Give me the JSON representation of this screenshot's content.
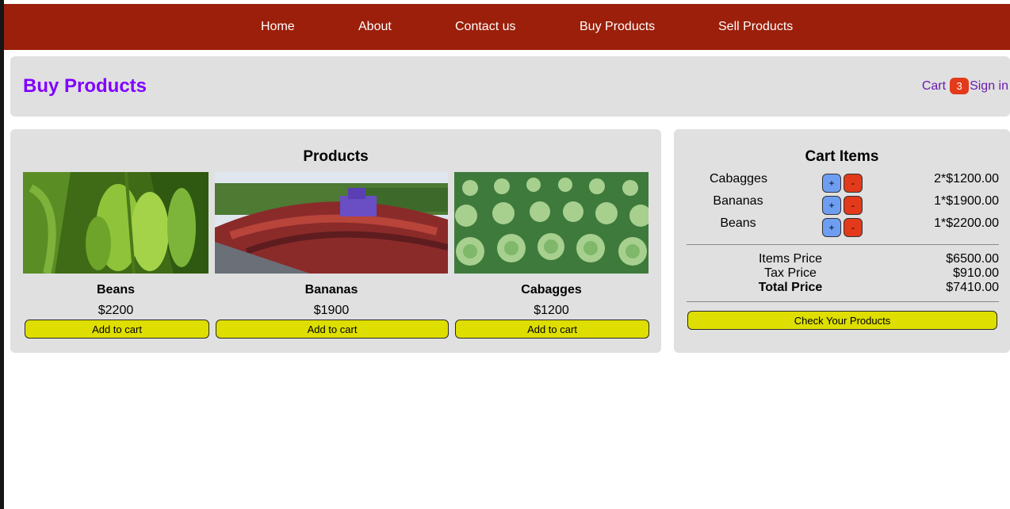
{
  "nav": {
    "links": [
      "Home",
      "About",
      "Contact us",
      "Buy Products",
      "Sell Products"
    ]
  },
  "header": {
    "title": "Buy Products",
    "cart_label": "Cart",
    "cart_count": "3",
    "signin_label": "Sign in"
  },
  "products": {
    "heading": "Products",
    "items": [
      {
        "name": "Beans",
        "price": "$2200",
        "button": "Add to cart",
        "image": "banana-plant-photo"
      },
      {
        "name": "Bananas",
        "price": "$1900",
        "button": "Add to cart",
        "image": "coffee-harvest-photo"
      },
      {
        "name": "Cabagges",
        "price": "$1200",
        "button": "Add to cart",
        "image": "cabbage-field-photo"
      }
    ]
  },
  "cart": {
    "heading": "Cart Items",
    "items": [
      {
        "name": "Cabagges",
        "plus": "+",
        "minus": "-",
        "price": "2*$1200.00"
      },
      {
        "name": "Bananas",
        "plus": "+",
        "minus": "-",
        "price": "1*$1900.00"
      },
      {
        "name": "Beans",
        "plus": "+",
        "minus": "-",
        "price": "1*$2200.00"
      }
    ],
    "items_price_label": "Items Price",
    "items_price": "$6500.00",
    "tax_label": "Tax Price",
    "tax_price": "$910.00",
    "total_label": "Total Price",
    "total_price": "$7410.00",
    "check_button": "Check Your Products"
  },
  "colors": {
    "nav_bg": "#9b1f0a",
    "title": "#8000ff",
    "badge": "#e23a1a",
    "add_button": "#dede00",
    "plus_button": "#6e9ef2",
    "minus_button": "#e23a1a",
    "panel_bg": "#e0e0e0"
  }
}
